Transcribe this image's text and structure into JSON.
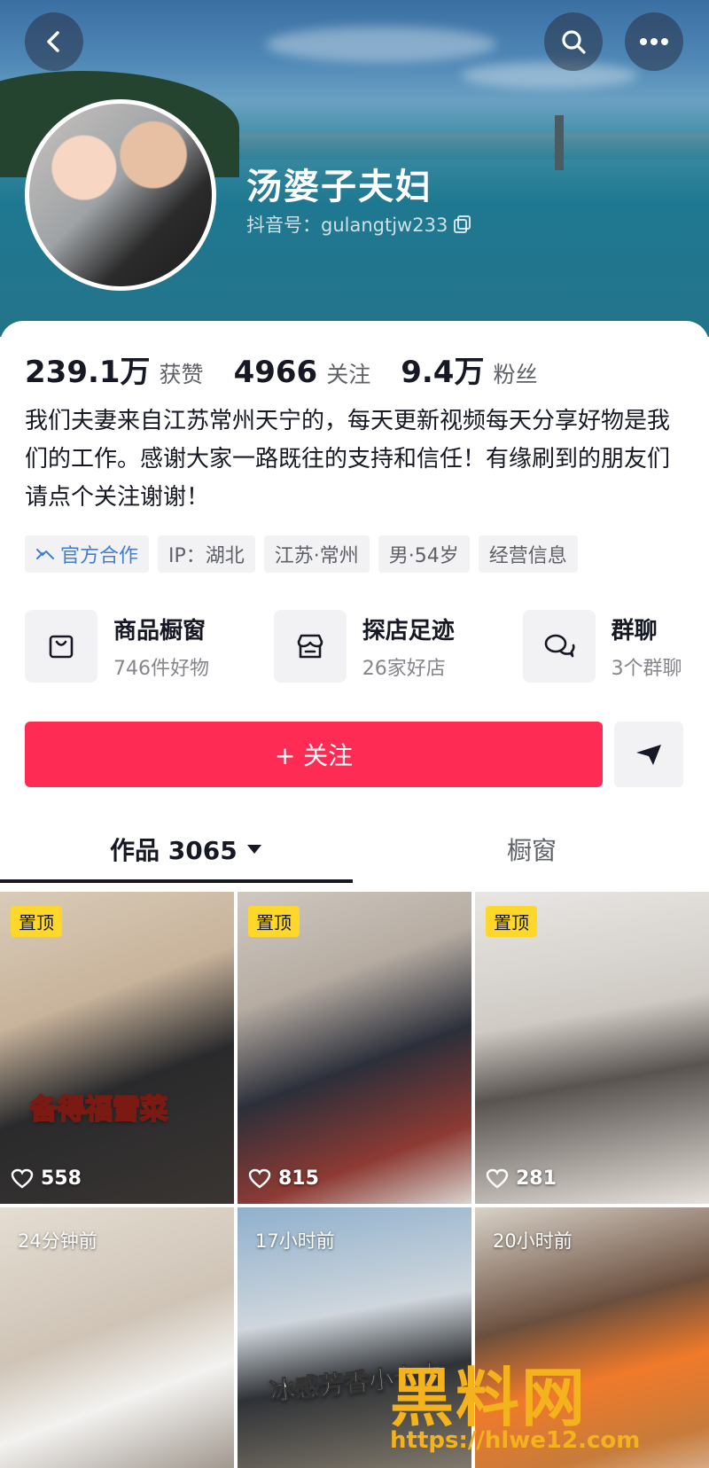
{
  "header": {
    "nickname": "汤婆子夫妇",
    "douyin_id": "抖音号：gulangtjw233"
  },
  "stats": [
    {
      "value": "239.1万",
      "label": "获赞"
    },
    {
      "value": "4966",
      "label": "关注"
    },
    {
      "value": "9.4万",
      "label": "粉丝"
    }
  ],
  "bio": "我们夫妻来自江苏常州天宁的，每天更新视频每天分享好物是我们的工作。感谢大家一路既往的支持和信任！有缘刷到的朋友们请点个关注谢谢！",
  "tags": [
    "官方合作",
    "IP：湖北",
    "江苏·常州",
    "男·54岁",
    "经营信息"
  ],
  "entries": [
    {
      "title": "商品橱窗",
      "sub": "746件好物"
    },
    {
      "title": "探店足迹",
      "sub": "26家好店"
    },
    {
      "title": "群聊",
      "sub": "3个群聊"
    }
  ],
  "actions": {
    "follow_label": "+ 关注"
  },
  "tabs": {
    "works_label": "作品 3065",
    "window_label": "橱窗"
  },
  "videos": [
    {
      "pin": "置顶",
      "likes": "558",
      "caption": "备得福雪菜"
    },
    {
      "pin": "置顶",
      "likes": "815"
    },
    {
      "pin": "置顶",
      "likes": "281"
    },
    {
      "time": "24分钟前"
    },
    {
      "time": "17小时前",
      "caption": "冰感芳香小卡巾"
    },
    {
      "time": "20小时前"
    }
  ],
  "watermark": {
    "logo": "黑料网",
    "url": "https://hlwe12.com"
  },
  "colors": {
    "accent": "#fe2c55",
    "pin_badge": "#fdd72a",
    "official_tag": "#3d7fd7"
  }
}
